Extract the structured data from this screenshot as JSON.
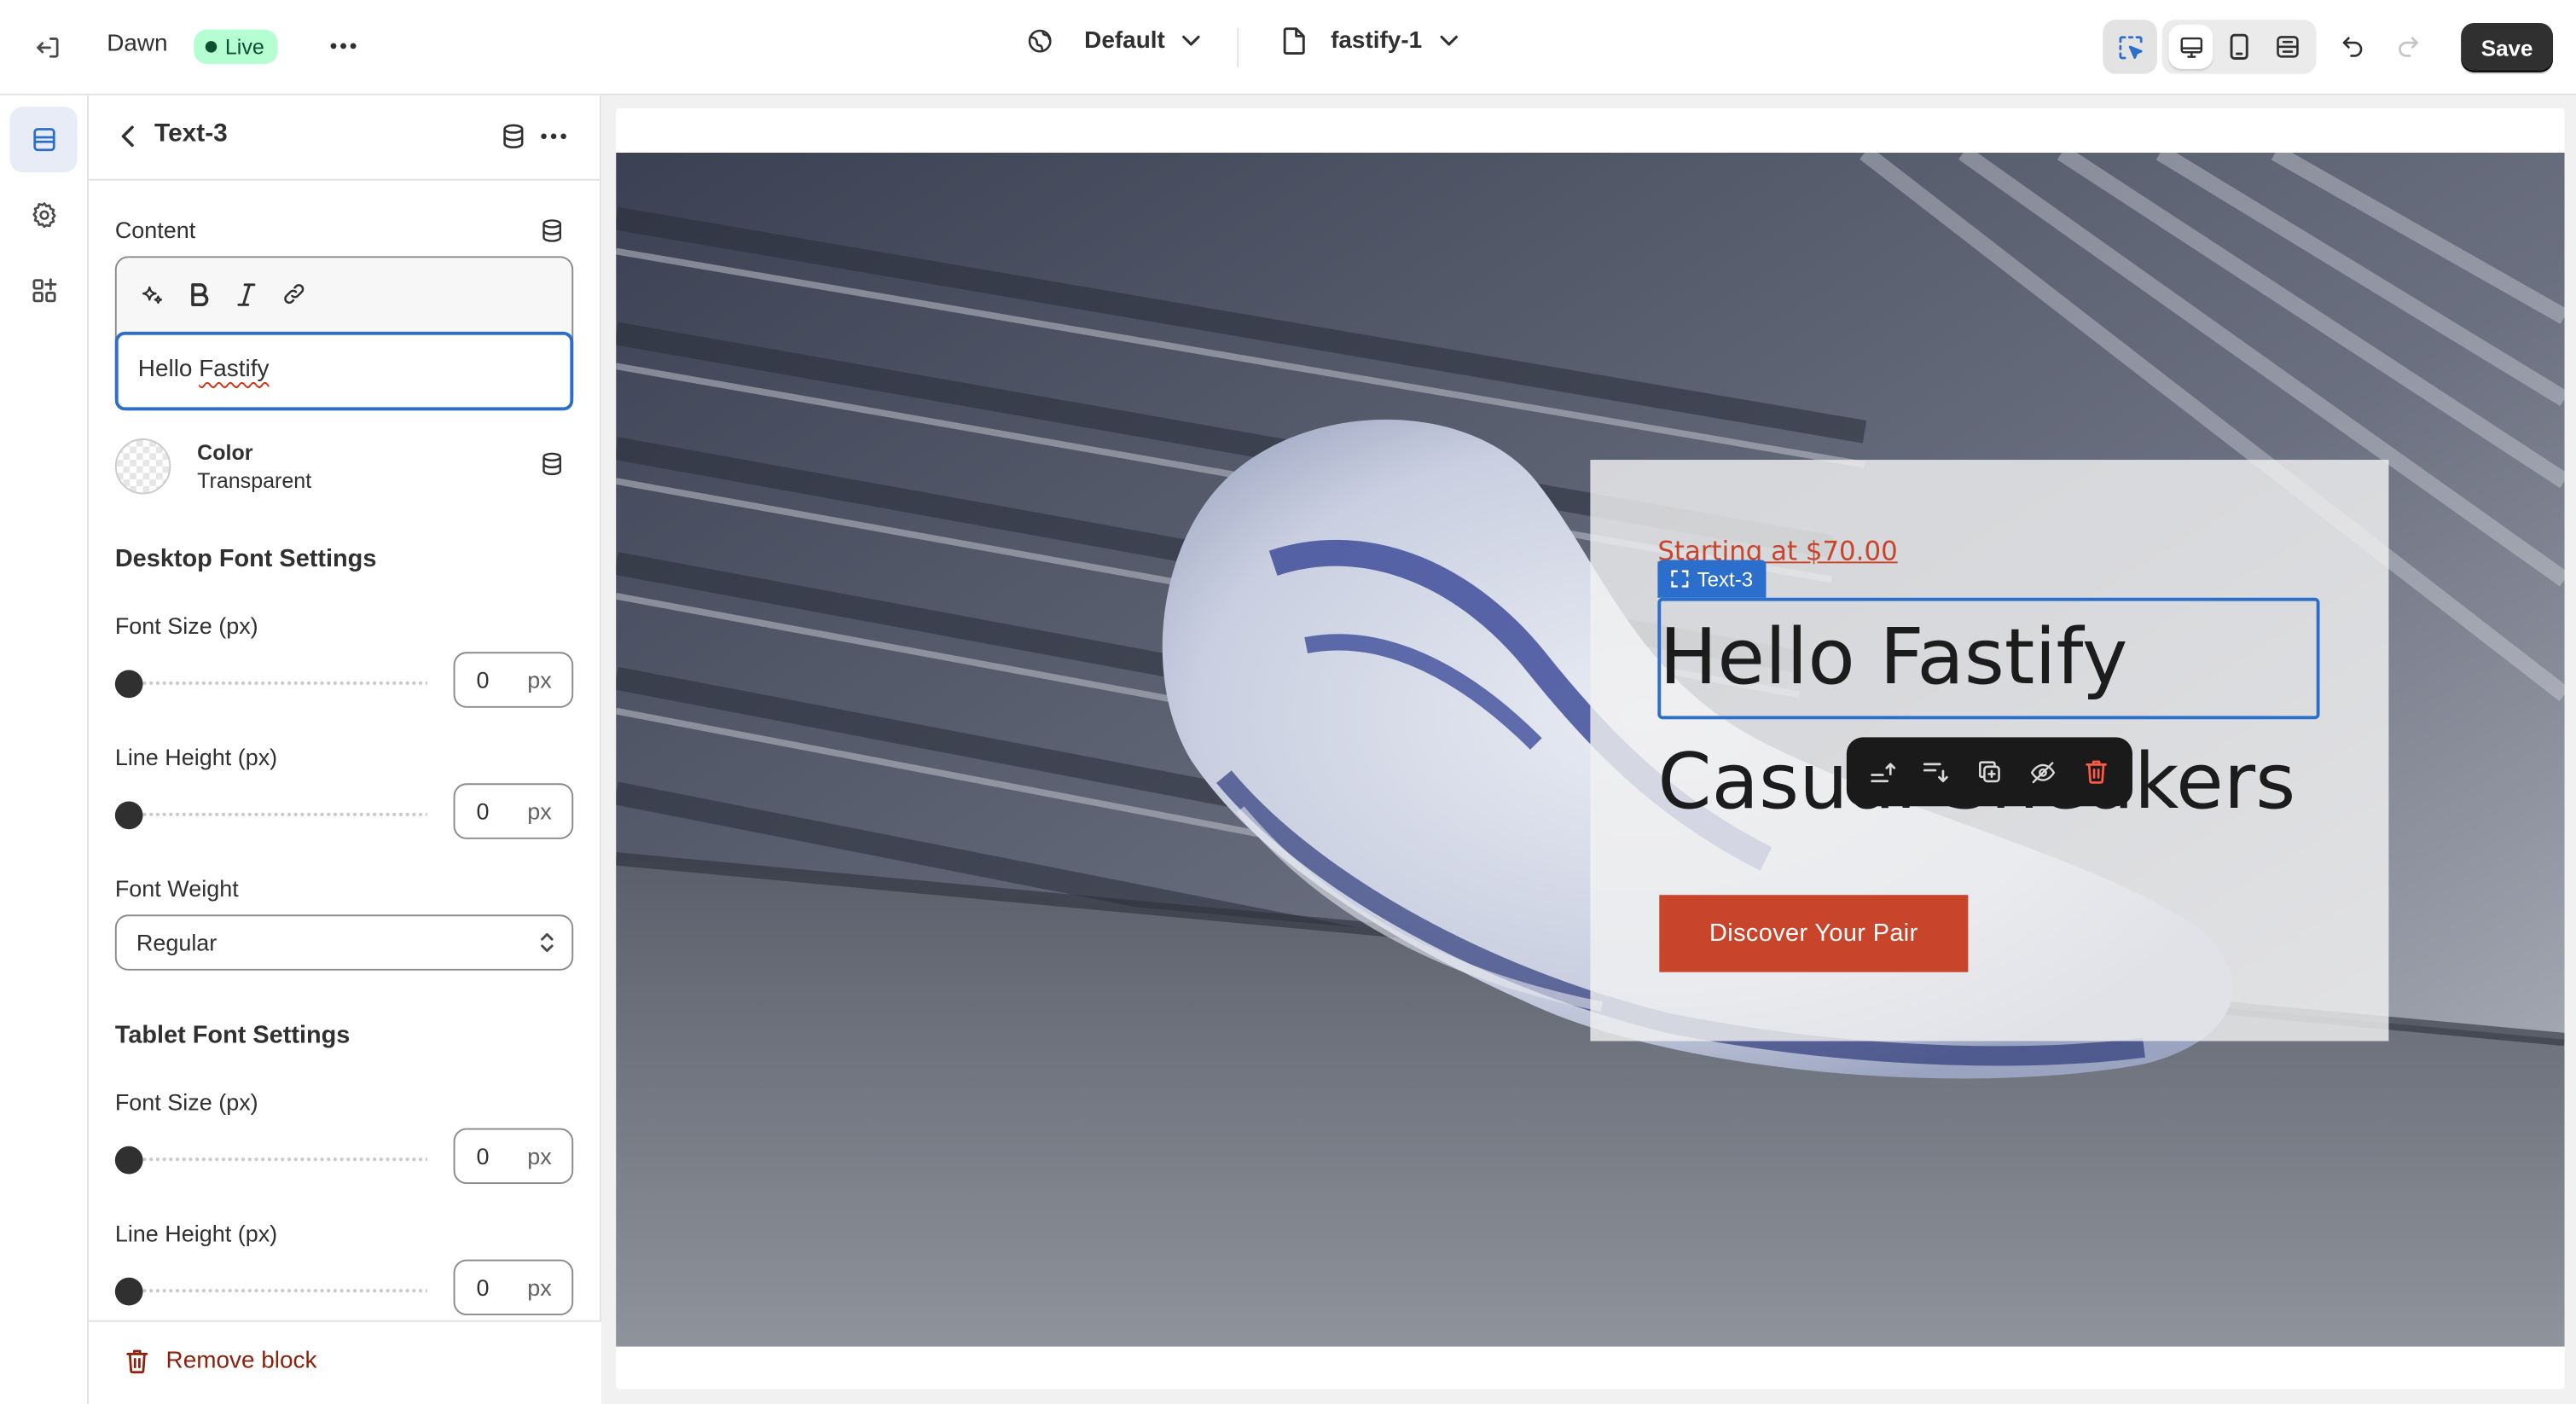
{
  "topbar": {
    "theme_name": "Dawn",
    "status_badge": "Live",
    "template_label": "Default",
    "page_label": "fastify-1",
    "save_label": "Save"
  },
  "icons": {
    "exit": "exit-icon",
    "more": "ellipsis-icon",
    "globe": "globe-icon",
    "page": "file-icon",
    "select_tool": "cursor-select-icon",
    "desktop": "desktop-icon",
    "mobile": "mobile-icon",
    "fullwidth": "fullwidth-icon",
    "undo": "undo-icon",
    "redo": "redo-icon",
    "sections": "sections-icon",
    "settings": "gear-icon",
    "apps": "apps-icon",
    "database": "database-icon"
  },
  "panel": {
    "title": "Text-3",
    "content_label": "Content",
    "content_value_before": "Hello ",
    "content_value_misspelled": "Fastify",
    "color_label": "Color",
    "color_value": "Transparent",
    "desktop_section": "Desktop Font Settings",
    "tablet_section": "Tablet Font Settings",
    "font_size_label": "Font Size (px)",
    "line_height_label": "Line Height (px)",
    "font_weight_label": "Font Weight",
    "font_weight_value": "Regular",
    "unit": "px",
    "desktop_font_size": "0",
    "desktop_line_height": "0",
    "tablet_font_size": "0",
    "tablet_line_height": "0",
    "remove_label": "Remove block"
  },
  "preview": {
    "subheading": "Starting at $70.00",
    "selected_block_tag": "Text-3",
    "heading": "Hello Fastify",
    "heading2": "Casual Sneakers",
    "cta_label": "Discover Your Pair"
  },
  "colors": {
    "accent_blue": "#2c6ecb",
    "brand_red": "#c8452b",
    "live_green": "#b4fed2",
    "save_dark": "#303030"
  }
}
